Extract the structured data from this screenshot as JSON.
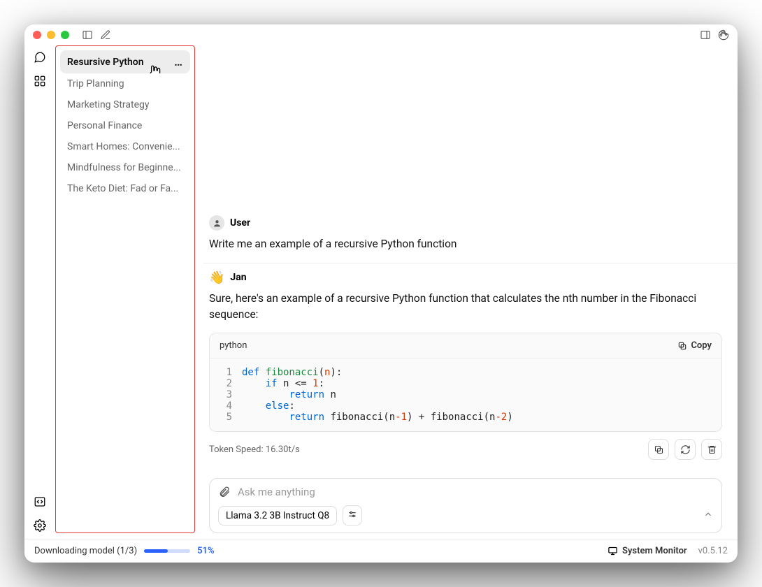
{
  "threads": [
    "Resursive Python",
    "Trip Planning",
    "Marketing Strategy",
    "Personal Finance",
    "Smart Homes: Convenie...",
    "Mindfulness for Beginne...",
    "The Keto Diet: Fad or Fa..."
  ],
  "chat": {
    "user_label": "User",
    "user_msg": "Write me an example of a recursive Python function",
    "jan_label": "Jan",
    "jan_msg": "Sure, here's an example of a recursive Python function that calculates the nth number in the Fibonacci sequence:",
    "code_lang": "python",
    "copy_label": "Copy",
    "code_lines": [
      {
        "n": "1",
        "pre": "",
        "kw": "def ",
        "fn": "fibonacci",
        "after1": "(",
        "arg": "n",
        "after2": "):"
      },
      {
        "n": "2",
        "pre": "    ",
        "kw": "if ",
        "plain": "n <= ",
        "num": "1",
        "after": ":"
      },
      {
        "n": "3",
        "pre": "        ",
        "kw": "return ",
        "plain": "n"
      },
      {
        "n": "4",
        "pre": "    ",
        "kw": "else",
        "after": ":"
      },
      {
        "n": "5",
        "pre": "        ",
        "kw": "return ",
        "plain": "fibonacci(n",
        "num1": "-1",
        "mid": ") + fibonacci(n",
        "num2": "-2",
        "end": ")"
      }
    ],
    "token_speed": "Token Speed: 16.30t/s"
  },
  "composer": {
    "placeholder": "Ask me anything",
    "model": "Llama 3.2 3B Instruct Q8"
  },
  "status": {
    "download": "Downloading model (1/3)",
    "pct": "51%",
    "sysmon": "System Monitor",
    "version": "v0.5.12"
  }
}
